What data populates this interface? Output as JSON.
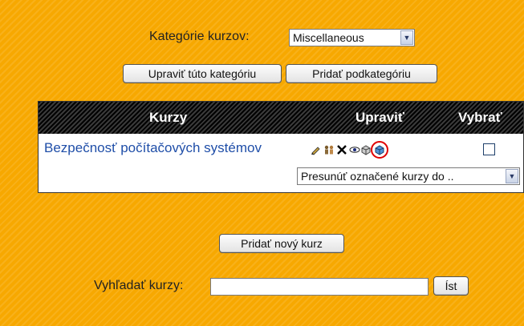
{
  "category": {
    "label": "Kategórie kurzov:",
    "selected": "Miscellaneous"
  },
  "buttons": {
    "edit_category": "Upraviť túto kategóriu",
    "add_subcategory": "Pridať podkategóriu",
    "add_course": "Pridať nový kurz",
    "go": "Íst"
  },
  "table": {
    "headers": {
      "courses": "Kurzy",
      "edit": "Upraviť",
      "select": "Vybrať"
    },
    "rows": [
      {
        "course": "Bezpečnosť počítačových systémov"
      }
    ],
    "move_select": "Presunúť označené kurzy do .."
  },
  "search": {
    "label": "Vyhľadať kurzy:",
    "value": ""
  },
  "colors": {
    "background": "#f7a800",
    "course_link": "#1f4ea8",
    "highlight": "#e00000"
  }
}
